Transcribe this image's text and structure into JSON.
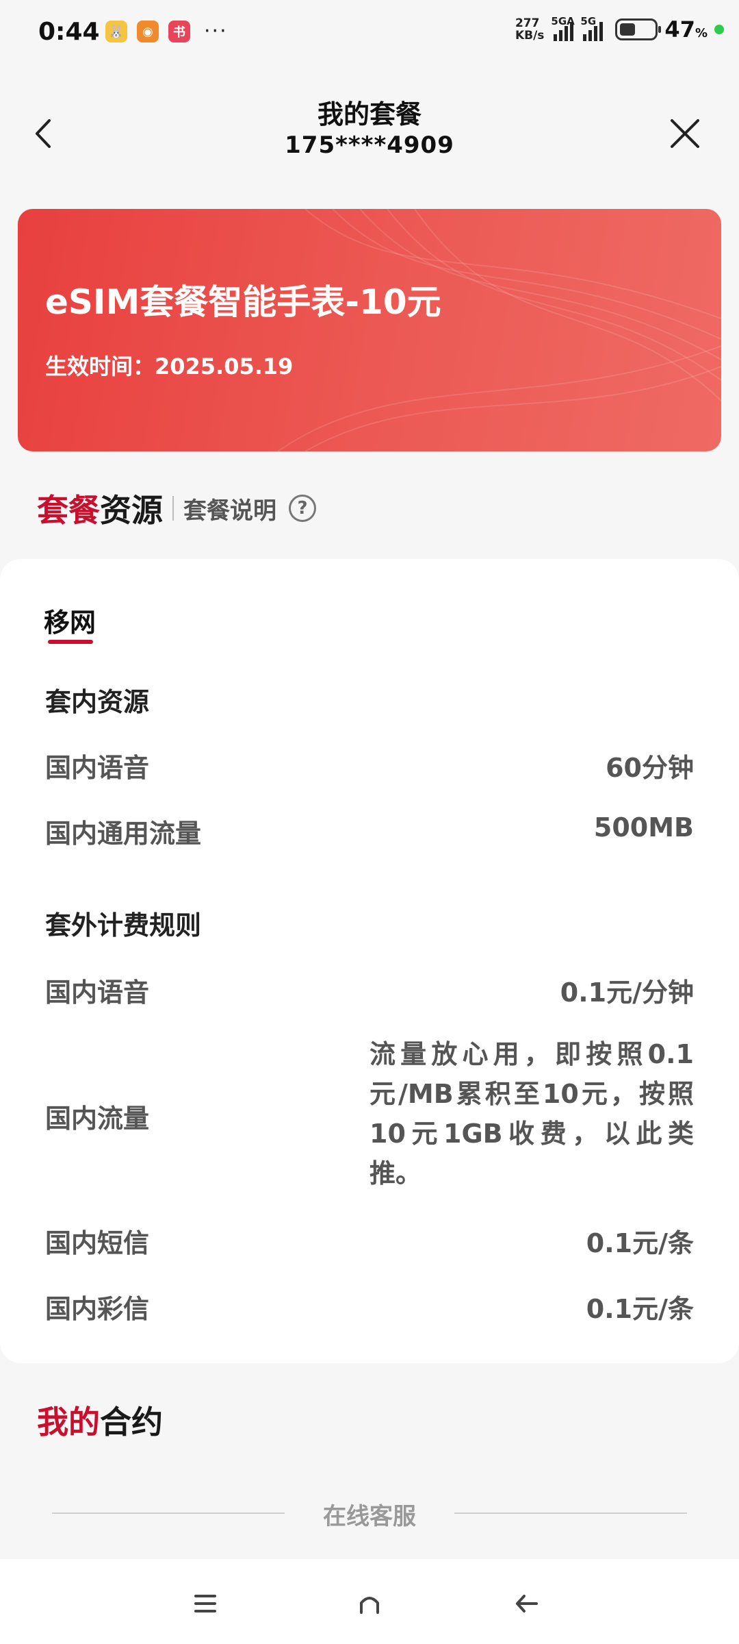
{
  "status_bar": {
    "time": "0:44",
    "apps": [
      {
        "icon": "bunny-app-icon",
        "color": "#f5c542",
        "glyph": "🐰"
      },
      {
        "icon": "weibo-icon",
        "color": "#f08a2c",
        "glyph": "◉"
      },
      {
        "icon": "reader-app-icon",
        "color": "#e8455a",
        "glyph": "书"
      }
    ],
    "more": "···",
    "net_speed_value": "277",
    "net_speed_unit": "KB/s",
    "signal1_label": "5GA",
    "signal2_label": "5G",
    "battery_percent": "47",
    "battery_percent_sign": "%"
  },
  "header": {
    "title": "我的套餐",
    "phone": "175****4909"
  },
  "plan_banner": {
    "name": "eSIM套餐智能手表-10元",
    "effective_date": "生效时间：2025.05.19",
    "accent_color": "#e8403e"
  },
  "resources_section": {
    "title_highlight": "套餐",
    "title_rest": "资源",
    "desc_link": "套餐说明",
    "help_glyph": "?"
  },
  "resources_card": {
    "tab": "移网",
    "included": {
      "title": "套内资源",
      "rows": [
        {
          "label": "国内语音",
          "value": "60分钟"
        },
        {
          "label": "国内通用流量",
          "value": "500MB"
        }
      ]
    },
    "extra": {
      "title": "套外计费规则",
      "voice": {
        "label": "国内语音",
        "value": "0.1元/分钟"
      },
      "data": {
        "label": "国内流量",
        "value": "流量放心用，即按照0.1元/MB累积至10元，按照10元1GB收费，以此类推。"
      },
      "sms": {
        "label": "国内短信",
        "value": "0.1元/条"
      },
      "mms": {
        "label": "国内彩信",
        "value": "0.1元/条"
      }
    }
  },
  "contract_section": {
    "title_highlight": "我的",
    "title_rest": "合约"
  },
  "online_service": {
    "label": "在线客服"
  },
  "system_nav": {
    "icons": [
      "menu-icon",
      "home-icon",
      "back-icon"
    ]
  }
}
